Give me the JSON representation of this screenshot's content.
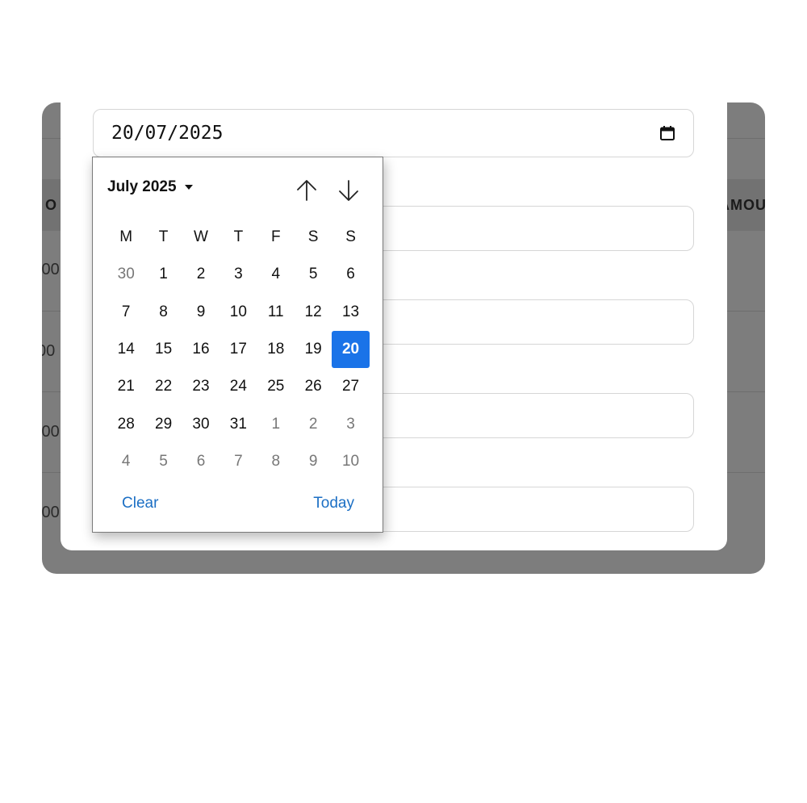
{
  "background_table": {
    "header_left": "O",
    "header_right": "AMOU",
    "rows": [
      ".00",
      "00",
      ".00",
      ".00"
    ]
  },
  "date_input": {
    "value": "20/07/2025",
    "icon": "calendar-icon"
  },
  "picker": {
    "month_label": "July 2025",
    "prev_icon": "arrow-up-icon",
    "next_icon": "arrow-down-icon",
    "weekdays": [
      "M",
      "T",
      "W",
      "T",
      "F",
      "S",
      "S"
    ],
    "weeks": [
      [
        {
          "d": "30",
          "m": true
        },
        {
          "d": "1"
        },
        {
          "d": "2"
        },
        {
          "d": "3"
        },
        {
          "d": "4"
        },
        {
          "d": "5"
        },
        {
          "d": "6"
        }
      ],
      [
        {
          "d": "7"
        },
        {
          "d": "8"
        },
        {
          "d": "9"
        },
        {
          "d": "10"
        },
        {
          "d": "11"
        },
        {
          "d": "12"
        },
        {
          "d": "13"
        }
      ],
      [
        {
          "d": "14"
        },
        {
          "d": "15"
        },
        {
          "d": "16"
        },
        {
          "d": "17"
        },
        {
          "d": "18"
        },
        {
          "d": "19"
        },
        {
          "d": "20",
          "sel": true
        }
      ],
      [
        {
          "d": "21"
        },
        {
          "d": "22"
        },
        {
          "d": "23"
        },
        {
          "d": "24"
        },
        {
          "d": "25"
        },
        {
          "d": "26"
        },
        {
          "d": "27"
        }
      ],
      [
        {
          "d": "28"
        },
        {
          "d": "29"
        },
        {
          "d": "30"
        },
        {
          "d": "31"
        },
        {
          "d": "1",
          "m": true
        },
        {
          "d": "2",
          "m": true
        },
        {
          "d": "3",
          "m": true
        }
      ],
      [
        {
          "d": "4",
          "m": true
        },
        {
          "d": "5",
          "m": true
        },
        {
          "d": "6",
          "m": true
        },
        {
          "d": "7",
          "m": true
        },
        {
          "d": "8",
          "m": true
        },
        {
          "d": "9",
          "m": true
        },
        {
          "d": "10",
          "m": true
        }
      ]
    ],
    "clear_label": "Clear",
    "today_label": "Today"
  },
  "colors": {
    "accent": "#1a73e8",
    "link": "#1c6fc4",
    "overlay": "#7d7d7d"
  }
}
